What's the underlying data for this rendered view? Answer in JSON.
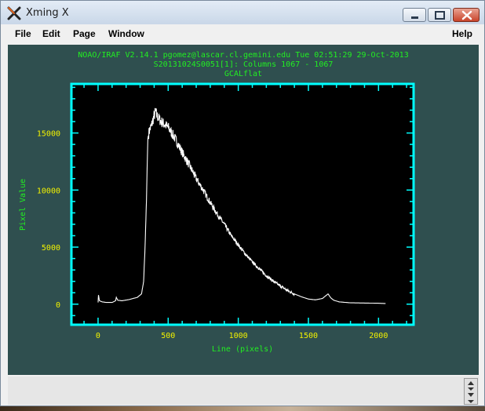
{
  "window": {
    "title": "Xming X",
    "app_icon": "xming-x-icon",
    "controls": {
      "minimize_icon": "minimize-icon",
      "maximize_icon": "maximize-icon",
      "close_icon": "close-icon"
    }
  },
  "menubar": {
    "file": "File",
    "edit": "Edit",
    "page": "Page",
    "window": "Window",
    "help": "Help"
  },
  "graph": {
    "header_line1": "NOAO/IRAF V2.14.1 pgomez@lascar.cl.gemini.edu Tue 02:51:29 29-Oct-2013",
    "header_line2": "S20131024S0051[1]: Columns 1067 - 1067",
    "header_line3": "GCALflat",
    "colors": {
      "background": "#2f4f4f",
      "plot_area": "#000000",
      "frame": "#00ffff",
      "text": "#22ee22",
      "ticks": "#f2f200",
      "data": "#ffffff"
    }
  },
  "chart_data": {
    "type": "line",
    "title": "GCALflat",
    "xlabel": "Line (pixels)",
    "ylabel": "Pixel Value",
    "xlim": [
      -190,
      2250
    ],
    "ylim": [
      -1800,
      19300
    ],
    "xticks": [
      0,
      500,
      1000,
      1500,
      2000
    ],
    "yticks": [
      0,
      5000,
      10000,
      15000
    ],
    "series": [
      {
        "x": [
          0,
          3,
          10,
          30,
          60,
          100,
          125,
          130,
          140,
          170,
          220,
          280,
          310,
          325,
          335,
          345,
          350,
          355,
          365,
          380,
          395,
          410,
          420,
          450,
          500,
          550,
          600,
          650,
          700,
          750,
          800,
          850,
          900,
          950,
          1000,
          1050,
          1100,
          1150,
          1200,
          1250,
          1300,
          1350,
          1400,
          1450,
          1500,
          1550,
          1600,
          1620,
          1640,
          1660,
          1680,
          1720,
          1800,
          1900,
          2000,
          2050
        ],
        "y": [
          150,
          800,
          300,
          200,
          150,
          150,
          300,
          600,
          350,
          300,
          400,
          600,
          900,
          2000,
          5000,
          9000,
          12000,
          14500,
          15200,
          15600,
          16300,
          16900,
          16500,
          16000,
          15500,
          14500,
          13300,
          12200,
          11000,
          10000,
          8900,
          7900,
          7000,
          6000,
          5200,
          4400,
          3700,
          3100,
          2500,
          2000,
          1600,
          1200,
          900,
          650,
          450,
          380,
          500,
          700,
          900,
          550,
          350,
          200,
          120,
          100,
          80,
          60
        ]
      }
    ]
  },
  "status": {
    "scroll_icon": "scroll-arrows-icon"
  }
}
